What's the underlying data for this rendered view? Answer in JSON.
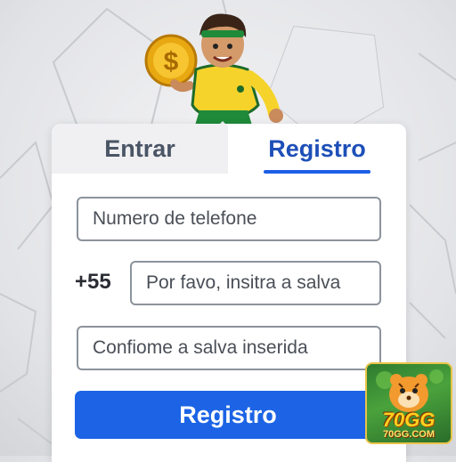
{
  "tabs": {
    "login_label": "Entrar",
    "register_label": "Registro",
    "active": "register"
  },
  "form": {
    "phone_placeholder": "Numero de telefone",
    "country_code": "+55",
    "password_placeholder": "Por favo, insitra a salva",
    "confirm_placeholder": "Confiome a salva inserida",
    "submit_label": "Registro"
  },
  "brand": {
    "badge_text": "70GG",
    "badge_site": "70GG.COM"
  },
  "colors": {
    "accent": "#1c64e5",
    "active_tab_text": "#1d4fb8",
    "inactive_tab_bg": "#f0f0f2"
  },
  "icons": [
    "soccer-ball-background",
    "mascot-player-illustration",
    "gold-coin-icon",
    "tiger-mascot-badge"
  ]
}
